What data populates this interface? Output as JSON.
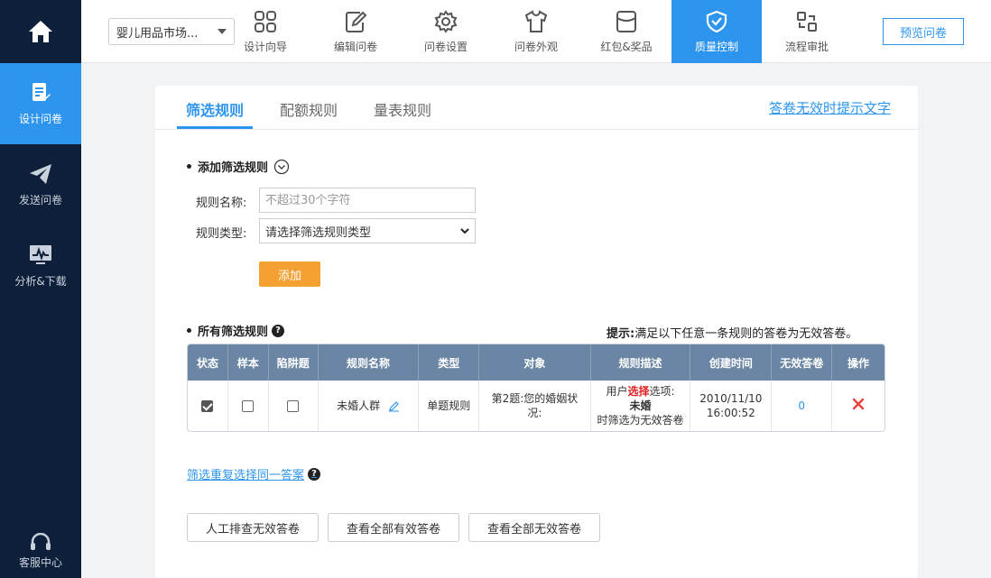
{
  "leftnav": {
    "items": [
      {
        "label": "设计问卷",
        "icon": "edit-doc-icon",
        "active": true
      },
      {
        "label": "发送问卷",
        "icon": "paper-plane-icon",
        "active": false
      },
      {
        "label": "分析&下载",
        "icon": "chart-monitor-icon",
        "active": false
      }
    ],
    "service_label": "客服中心"
  },
  "topbar": {
    "survey_name": "婴儿用品市场...",
    "tabs": [
      {
        "label": "设计向导",
        "icon": "grid-icon"
      },
      {
        "label": "编辑问卷",
        "icon": "edit-icon"
      },
      {
        "label": "问卷设置",
        "icon": "gear-icon"
      },
      {
        "label": "问卷外观",
        "icon": "shirt-icon"
      },
      {
        "label": "红包&奖品",
        "icon": "envelope-icon"
      },
      {
        "label": "质量控制",
        "icon": "shield-check-icon",
        "active": true
      },
      {
        "label": "流程审批",
        "icon": "flow-icon"
      }
    ],
    "preview_label": "预览问卷"
  },
  "subtabs": [
    "筛选规则",
    "配额规则",
    "量表规则"
  ],
  "invalid_link": "答卷无效时提示文字",
  "add_section": {
    "title": "添加筛选规则",
    "name_label": "规则名称:",
    "name_placeholder": "不超过30个字符",
    "type_label": "规则类型:",
    "type_value": "请选择筛选规则类型",
    "add_button": "添加"
  },
  "rules_section": {
    "title": "所有筛选规则",
    "tip_label": "提示:",
    "tip_text": "满足以下任意一条规则的答卷为无效答卷。",
    "headers": [
      "状态",
      "样本",
      "陷阱题",
      "规则名称",
      "类型",
      "对象",
      "规则描述",
      "创建时间",
      "无效答卷",
      "操作"
    ],
    "rows": [
      {
        "status_checked": true,
        "sample_checked": false,
        "trap_checked": false,
        "name": "未婚人群",
        "type": "单题规则",
        "target_line1": "第2题:您的婚姻状",
        "target_line2": "况:",
        "desc_prefix": "用户",
        "desc_highlight": "选择",
        "desc_suffix": "选项:",
        "desc_option": "未婚",
        "desc_end": "时筛选为无效答卷",
        "created_date": "2010/11/10",
        "created_time": "16:00:52",
        "invalid_count": "0"
      }
    ]
  },
  "dup_link": "筛选重复选择同一答案",
  "bottom_buttons": [
    "人工排查无效答卷",
    "查看全部有效答卷",
    "查看全部无效答卷"
  ],
  "colors": {
    "accent": "#2e95ee",
    "sidebar": "#0e1f3a",
    "add_button": "#f5a033",
    "table_header": "#6b86a5"
  }
}
